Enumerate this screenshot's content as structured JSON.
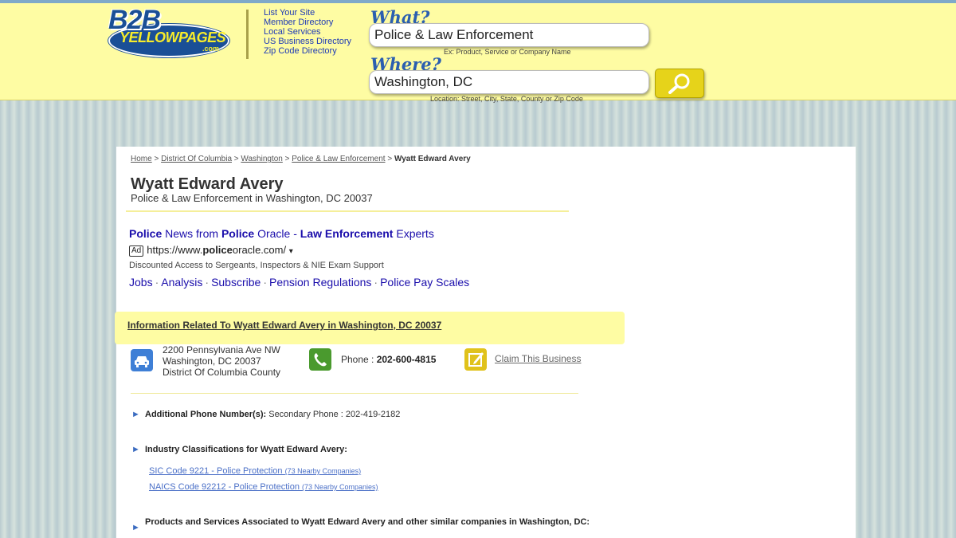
{
  "header": {
    "logo_text": "B2B YELLOWPAGES .com",
    "nav_links": [
      "List Your Site",
      "Member Directory",
      "Local Services",
      "US Business Directory",
      "Zip Code Directory"
    ],
    "what_label": "What?",
    "what_value": "Police & Law Enforcement",
    "what_hint": "Ex: Product, Service or Company Name",
    "where_label": "Where?",
    "where_value": "Washington, DC",
    "where_hint": "Location: Street, City, State, County or Zip Code"
  },
  "breadcrumb": {
    "items": [
      "Home",
      "District Of Columbia",
      "Washington",
      "Police & Law Enforcement"
    ],
    "separator": ">",
    "current": "Wyatt Edward Avery"
  },
  "business": {
    "name": "Wyatt Edward Avery",
    "subtitle": "Police & Law Enforcement in Washington, DC 20037"
  },
  "ad": {
    "title_parts": [
      "Police",
      " News from ",
      "Police",
      " Oracle - ",
      "Law Enforcement",
      " Experts"
    ],
    "badge": "Ad",
    "url_pre": "https://www.",
    "url_bold": "police",
    "url_post": "oracle.com/",
    "dropdown": "▾",
    "description": "Discounted Access to Sergeants, Inspectors & NIE Exam Support",
    "links": [
      "Jobs",
      "Analysis",
      "Subscribe",
      "Pension Regulations",
      "Police Pay Scales"
    ],
    "link_sep": "·"
  },
  "info": {
    "banner": "Information Related To Wyatt Edward Avery in Washington, DC 20037",
    "address_lines": [
      "2200 Pennsylvania Ave NW",
      "Washington, DC 20037",
      "District Of Columbia County"
    ],
    "phone_label": "Phone : ",
    "phone": "202-600-4815",
    "claim": "Claim This Business"
  },
  "details": {
    "bullet": "►",
    "additional_label": "Additional Phone Number(s):",
    "additional_value": " Secondary Phone : 202-419-2182",
    "industry_label": "Industry Classifications for Wyatt Edward Avery:",
    "codes": [
      {
        "text": "SIC Code 9221 - Police Protection ",
        "count": "(73 Nearby Companies)"
      },
      {
        "text": "NAICS Code 92212 - Police Protection ",
        "count": "(73 Nearby Companies)"
      }
    ],
    "products_label": "Products and Services Associated to Wyatt Edward Avery and other similar companies in Washington, DC:"
  },
  "colors": {
    "header_bg": "#fefca3",
    "link_blue": "#1a0dab",
    "accent_yellow": "#e6d31a",
    "icon_blue": "#3e7fd6",
    "icon_green": "#4a9a2e"
  }
}
